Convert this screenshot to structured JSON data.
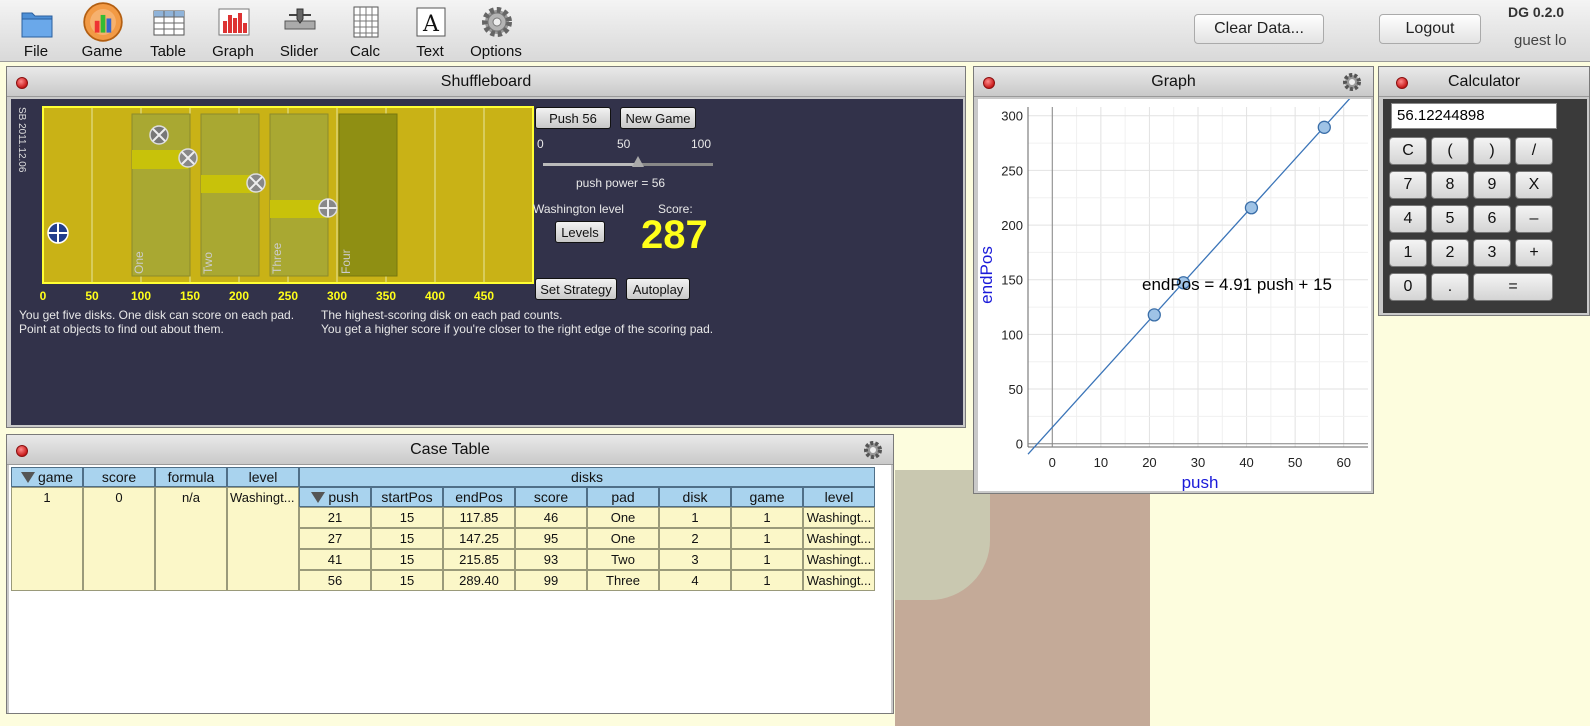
{
  "toolbar": {
    "items": [
      {
        "label": "File",
        "icon": "folder-icon"
      },
      {
        "label": "Game",
        "icon": "game-icon"
      },
      {
        "label": "Table",
        "icon": "table-icon"
      },
      {
        "label": "Graph",
        "icon": "graph-icon"
      },
      {
        "label": "Slider",
        "icon": "slider-icon"
      },
      {
        "label": "Calc",
        "icon": "calc-icon"
      },
      {
        "label": "Text",
        "icon": "text-icon"
      },
      {
        "label": "Options",
        "icon": "gear-icon"
      }
    ],
    "clear_data": "Clear Data...",
    "logout": "Logout",
    "brand": "DG 0.2.0",
    "user": "guest lo"
  },
  "shuffleboard": {
    "title": "Shuffleboard",
    "version": "SB 2011.12.06",
    "pads": [
      "One",
      "Two",
      "Three",
      "Four"
    ],
    "ticks": [
      "0",
      "50",
      "100",
      "150",
      "200",
      "250",
      "300",
      "350",
      "400",
      "450"
    ],
    "push_button": "Push 56",
    "new_game": "New Game",
    "slider": {
      "min": "0",
      "mid": "50",
      "max": "100",
      "value": 56
    },
    "push_power": "push power = 56",
    "level_label": "Washington level",
    "levels_button": "Levels",
    "score_label": "Score:",
    "score": "287",
    "set_strategy": "Set Strategy",
    "autoplay": "Autoplay",
    "help1a": "You get five disks. One disk can score on each pad.",
    "help1b": "Point at objects to find out about them.",
    "help2a": "The highest-scoring disk on each pad counts.",
    "help2b": "You get a higher score if you're closer to the right edge of the scoring pad."
  },
  "graph": {
    "title": "Graph",
    "equation": "endPos = 4.91 push + 15",
    "x_ticks": [
      "0",
      "10",
      "20",
      "30",
      "40",
      "50",
      "60"
    ],
    "y_ticks": [
      "0",
      "50",
      "100",
      "150",
      "200",
      "250",
      "300"
    ]
  },
  "chart_data": {
    "type": "scatter",
    "xlabel": "push",
    "ylabel": "endPos",
    "xlim": [
      -5,
      65
    ],
    "ylim": [
      -3,
      308
    ],
    "x": [
      21,
      27,
      41,
      56
    ],
    "y": [
      117.85,
      147.25,
      215.85,
      289.4
    ],
    "fit": {
      "slope": 4.91,
      "intercept": 15
    },
    "grid": true
  },
  "calculator": {
    "title": "Calculator",
    "display": "56.12244898",
    "keys": [
      "C",
      "(",
      ")",
      "/",
      "7",
      "8",
      "9",
      "X",
      "4",
      "5",
      "6",
      "–",
      "1",
      "2",
      "3",
      "+",
      "0",
      ".",
      "="
    ]
  },
  "case_table": {
    "title": "Case Table",
    "parent_headers": [
      "game",
      "score",
      "formula",
      "level"
    ],
    "parent_row": [
      "1",
      "0",
      "n/a",
      "Washingt..."
    ],
    "group_header": "disks",
    "child_headers": [
      "push",
      "startPos",
      "endPos",
      "score",
      "pad",
      "disk",
      "game",
      "level"
    ],
    "child_rows": [
      [
        "21",
        "15",
        "117.85",
        "46",
        "One",
        "1",
        "1",
        "Washingt..."
      ],
      [
        "27",
        "15",
        "147.25",
        "95",
        "One",
        "2",
        "1",
        "Washingt..."
      ],
      [
        "41",
        "15",
        "215.85",
        "93",
        "Two",
        "3",
        "1",
        "Washingt..."
      ],
      [
        "56",
        "15",
        "289.40",
        "99",
        "Three",
        "4",
        "1",
        "Washingt..."
      ]
    ]
  }
}
